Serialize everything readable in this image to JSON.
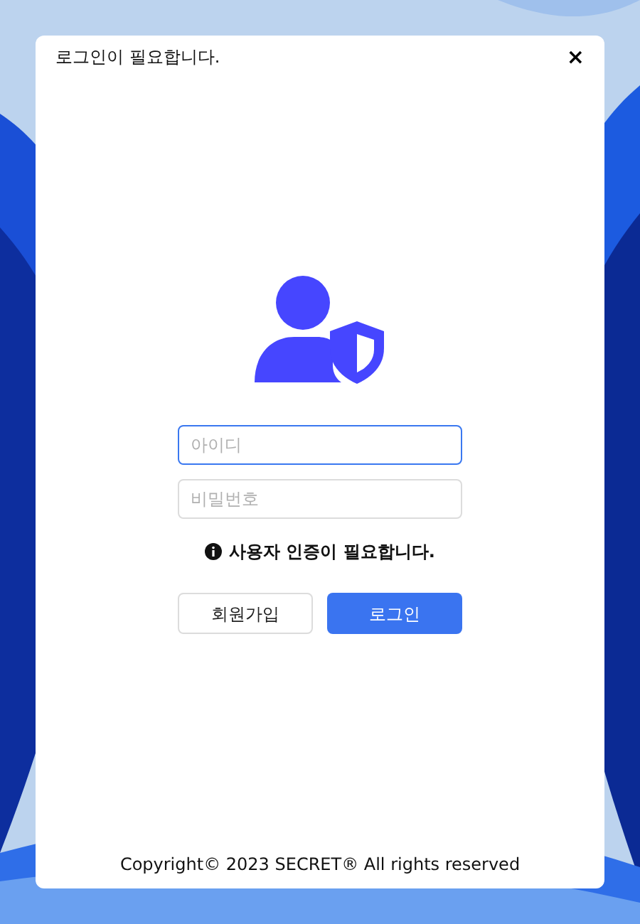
{
  "window": {
    "title": "로그인이 필요합니다.",
    "close": "×"
  },
  "fields": [
    {
      "placeholder": "아이디",
      "focused": true
    },
    {
      "placeholder": "비밀번호",
      "focused": false
    }
  ],
  "message": "사용자 인증이 필요합니다.",
  "buttons": [
    {
      "label": "회원가입",
      "kind": "secondary"
    },
    {
      "label": "로그인",
      "kind": "primary"
    }
  ],
  "footer": "Copyright© 2023 SECRET® All rights reserved"
}
